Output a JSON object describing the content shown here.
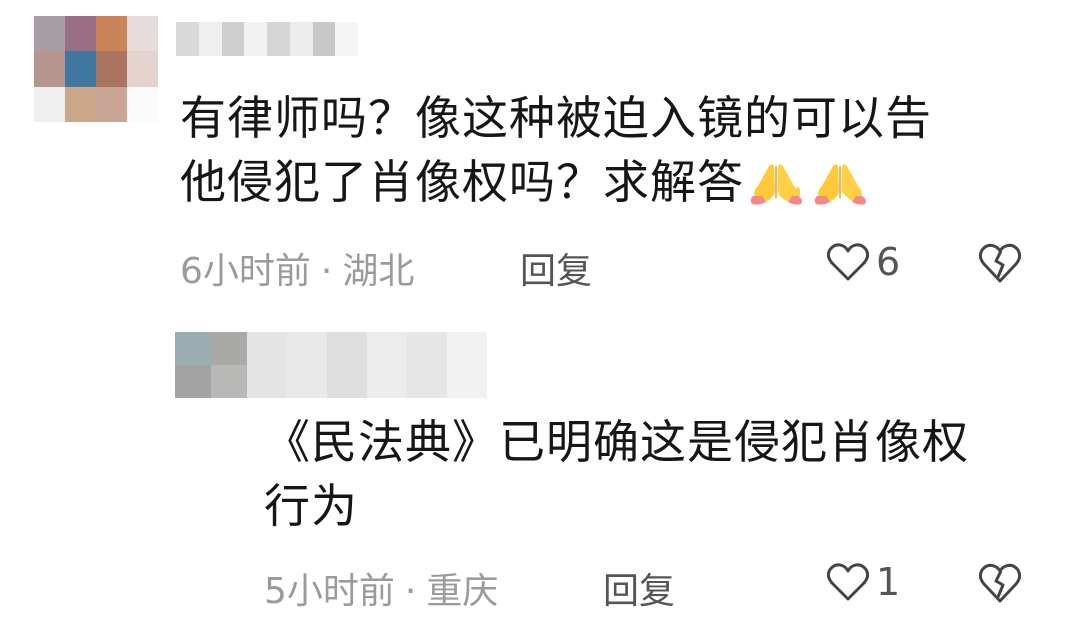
{
  "comments": [
    {
      "text": "有律师吗？像这种被迫入镜的可以告\n他侵犯了肖像权吗？求解答",
      "emoji": "folded-hands",
      "time": "6小时前",
      "separator": "·",
      "location": "湖北",
      "reply_label": "回复",
      "likes": "6",
      "avatar_palette": [
        "#a89ea6",
        "#9b6f86",
        "#c98558",
        "#e7dcdc",
        "#b5958e",
        "#3f77a0",
        "#ab7460",
        "#e4d2cc",
        "#efefef",
        "#cba88a",
        "#c9a596",
        "#fafafa"
      ],
      "username_palette": [
        "#d9d9d9",
        "#efefef",
        "#cfcfcf",
        "#f2f2f2",
        "#d5d5d5",
        "#ececec",
        "#c8c8c8",
        "#f5f5f5"
      ]
    },
    {
      "text": "《民法典》已明确这是侵犯肖像权\n行为",
      "time": "5小时前",
      "separator": "·",
      "location": "重庆",
      "reply_label": "回复",
      "likes": "1",
      "avatar_palette": [
        "#9aaeb1",
        "#a9a9a7",
        "#a3a3a4",
        "#b8b8b6"
      ],
      "username_palette": [
        "#e4e4e4",
        "#e9e9e9",
        "#dedede",
        "#ececec",
        "#e6e6e6",
        "#f1f1f1"
      ]
    }
  ]
}
